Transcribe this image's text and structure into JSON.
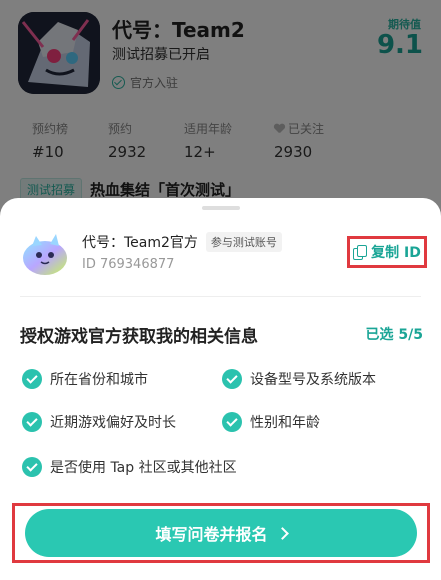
{
  "game": {
    "title": "代号：Team2",
    "subtitle": "测试招募已开启",
    "official": "官方入驻",
    "expect_label": "期待值",
    "expect_score": "9.1"
  },
  "stats": [
    {
      "label": "预约榜",
      "value": "#10"
    },
    {
      "label": "预约",
      "value": "2932"
    },
    {
      "label": "适用年龄",
      "value": "12+"
    },
    {
      "label": "已关注",
      "value": "2930"
    }
  ],
  "recruit": {
    "tag": "测试招募",
    "text": "热血集结「首次测试」"
  },
  "sheet": {
    "account_name": "代号：Team2官方",
    "account_badge": "参与测试账号",
    "account_id": "ID 769346877",
    "copy_label": "复制 ID",
    "auth_title": "授权游戏官方获取我的相关信息",
    "auth_count": "已选 5/5",
    "permissions": [
      "所在省份和城市",
      "设备型号及系统版本",
      "近期游戏偏好及时长",
      "性别和年龄",
      "是否使用 Tap 社区或其他社区"
    ],
    "submit_label": "填写问卷并报名"
  },
  "colors": {
    "accent": "#2ac8b2",
    "accent_text": "#1aa596",
    "highlight_border": "#e0393f"
  }
}
